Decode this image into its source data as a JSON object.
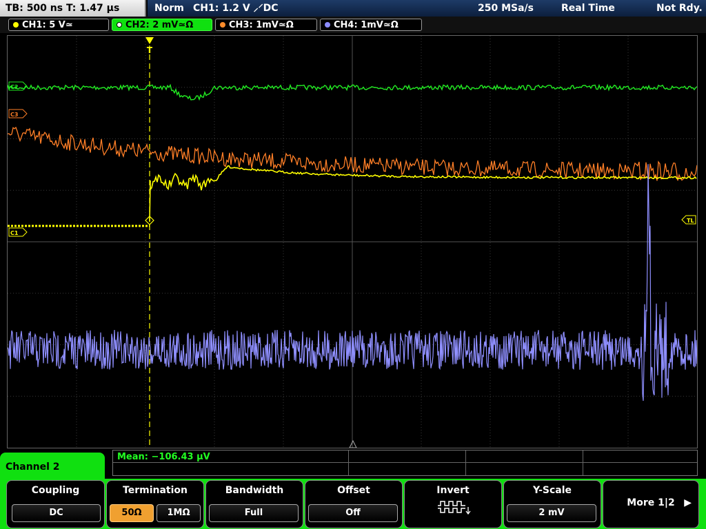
{
  "status": {
    "timebase": "TB: 500 ns   T: 1.47 µs",
    "mode": "Norm",
    "trigger": "CH1: 1.2 V ⸝⸍DC",
    "sample_rate": "250 MSa/s",
    "acquisition": "Real Time",
    "ready_state": "Not Rdy."
  },
  "channel_tabs": [
    {
      "label": "CH1: 5 V≃",
      "color": "#ffff00"
    },
    {
      "label": "CH2: 2 mV≃Ω",
      "color": "#22ff22",
      "active": true
    },
    {
      "label": "CH3: 1mV≃Ω",
      "color": "#ff8c2a"
    },
    {
      "label": "CH4: 1mV≃Ω",
      "color": "#8c8cff"
    }
  ],
  "markers": {
    "ch2": "C2",
    "ch3": "C3",
    "ch1": "C1",
    "trigger_level": "TL",
    "trigger_pos": "T"
  },
  "measurement": {
    "mean": "Mean: −106.43 µV"
  },
  "menu": {
    "title": "Channel 2",
    "coupling": {
      "label": "Coupling",
      "value": "DC"
    },
    "termination": {
      "label": "Termination",
      "option_a": "50Ω",
      "option_b": "1MΩ",
      "selected": "50Ω"
    },
    "bandwidth": {
      "label": "Bandwidth",
      "value": "Full"
    },
    "offset": {
      "label": "Offset",
      "value": "Off"
    },
    "invert": {
      "label": "Invert",
      "icon": "invert-icon"
    },
    "yscale": {
      "label": "Y-Scale",
      "value": "2 mV"
    },
    "more": {
      "label": "More 1|2"
    }
  },
  "colors": {
    "ch1": "#ffff00",
    "ch2": "#22ff22",
    "ch3": "#ff7f27",
    "ch4": "#8f8fff",
    "menu_accent": "#10e010"
  }
}
